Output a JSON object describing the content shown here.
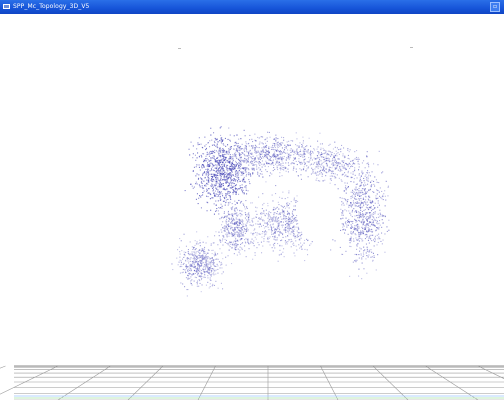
{
  "window": {
    "title": "SPP_Mc_Topology_3D_V5",
    "corner_button_icon": "restore-icon",
    "titlebar_color": "#1654d8"
  },
  "viewport": {
    "background": "#ffffff",
    "point_color": "#4a4ab8",
    "floor_grid_color": "#9a9a9a"
  }
}
